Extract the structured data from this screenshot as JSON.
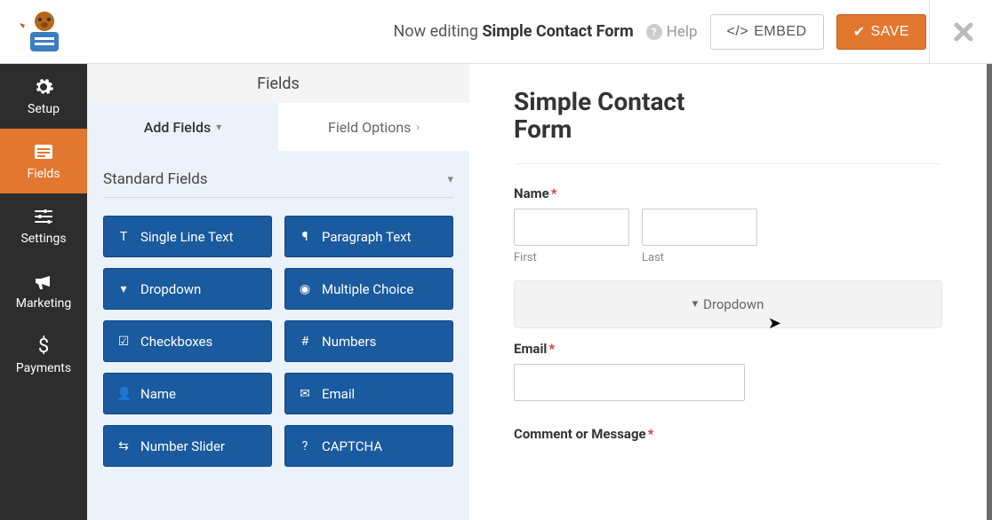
{
  "header": {
    "editing_prefix": "Now editing ",
    "form_name": "Simple Contact Form",
    "help_label": "Help",
    "embed_label": "EMBED",
    "save_label": "SAVE"
  },
  "nav": {
    "setup": "Setup",
    "fields": "Fields",
    "settings": "Settings",
    "marketing": "Marketing",
    "payments": "Payments"
  },
  "panel": {
    "title": "Fields",
    "tab_add": "Add Fields",
    "tab_options": "Field Options",
    "group_standard": "Standard Fields",
    "fields": {
      "single_line": "Single Line Text",
      "paragraph": "Paragraph Text",
      "dropdown": "Dropdown",
      "multiple_choice": "Multiple Choice",
      "checkboxes": "Checkboxes",
      "numbers": "Numbers",
      "name": "Name",
      "email": "Email",
      "number_slider": "Number Slider",
      "captcha": "CAPTCHA"
    }
  },
  "preview": {
    "form_title": "Simple Contact Form",
    "name_label": "Name",
    "first_sub": "First",
    "last_sub": "Last",
    "drop_label": "Dropdown",
    "email_label": "Email",
    "comment_label": "Comment or Message",
    "required_mark": "*"
  }
}
